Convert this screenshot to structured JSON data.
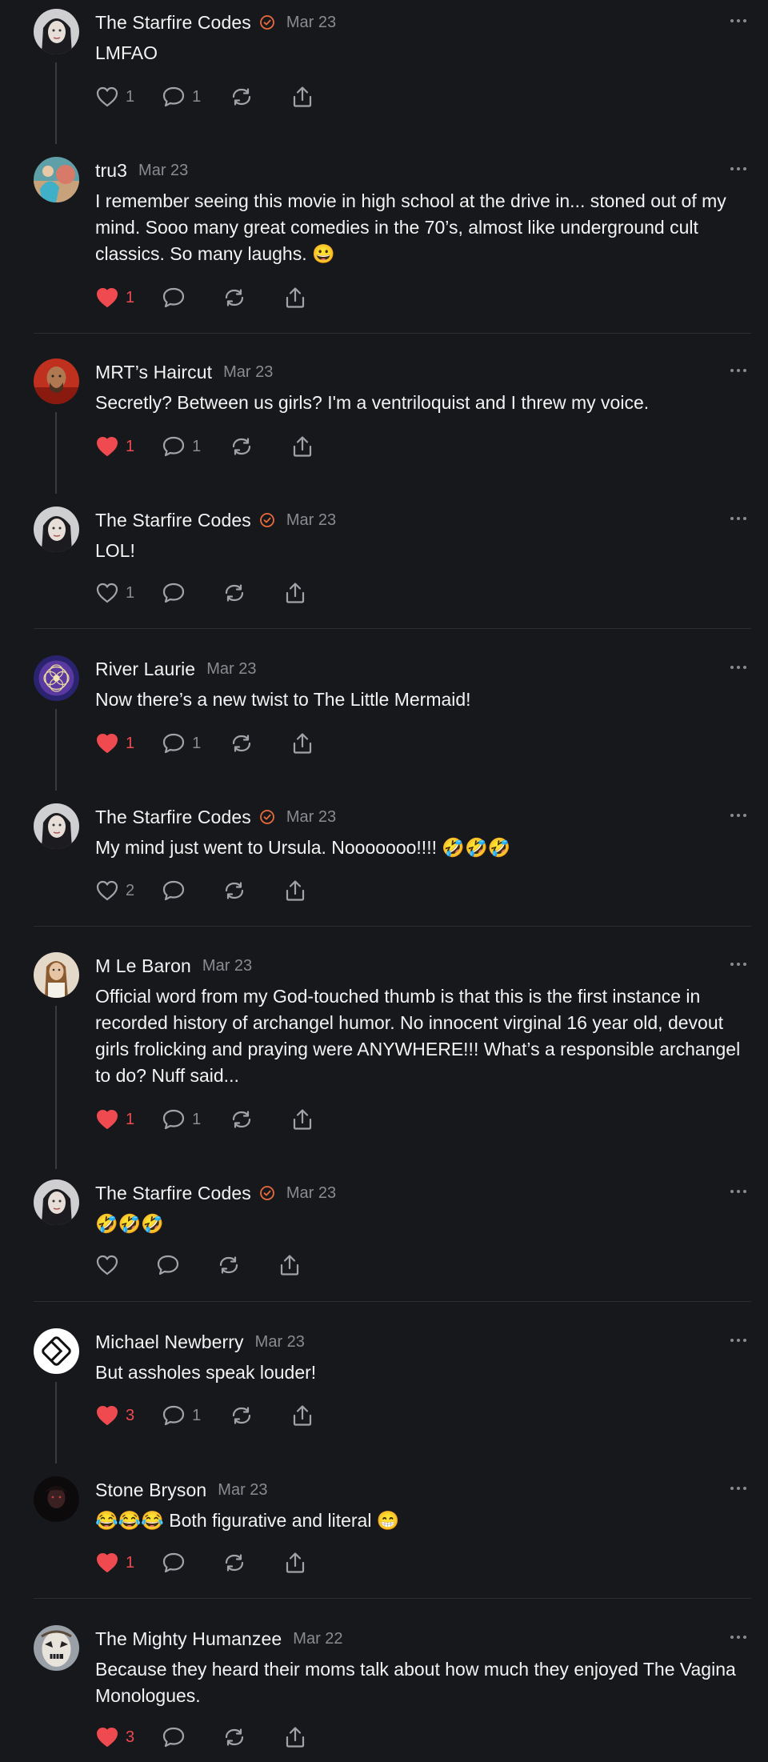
{
  "colors": {
    "background": "#17181b",
    "heart_red": "#ee4a50",
    "verified_orange": "#ea6b3c",
    "muted": "#8a8b90"
  },
  "posts": [
    {
      "author": "The Starfire Codes",
      "verified": true,
      "date": "Mar 23",
      "text": "LMFAO",
      "liked": false,
      "likes": "1",
      "replies": "1",
      "avatar": "woman-avatar"
    },
    {
      "author": "tru3",
      "verified": false,
      "date": "Mar 23",
      "text": "I remember seeing this movie in high school at the drive in... stoned out of my mind. Sooo many great comedies in the 70’s, almost like underground cult classics. So many laughs. 😀",
      "liked": true,
      "likes": "1",
      "replies": "",
      "avatar": "beach-avatar"
    },
    {
      "author": "MRT’s Haircut",
      "verified": false,
      "date": "Mar 23",
      "text": "Secretly? Between us girls? I'm a ventriloquist and I threw my voice.",
      "liked": true,
      "likes": "1",
      "replies": "1",
      "avatar": "man-red-avatar"
    },
    {
      "author": "The Starfire Codes",
      "verified": true,
      "date": "Mar 23",
      "text": "LOL!",
      "liked": false,
      "likes": "1",
      "replies": "",
      "avatar": "woman-avatar"
    },
    {
      "author": "River Laurie",
      "verified": false,
      "date": "Mar 23",
      "text": "Now there’s a new twist to The Little Mermaid!",
      "liked": true,
      "likes": "1",
      "replies": "1",
      "avatar": "mandala-avatar"
    },
    {
      "author": "The Starfire Codes",
      "verified": true,
      "date": "Mar 23",
      "text": "My mind just went to Ursula. Nooooooo!!!! 🤣🤣🤣",
      "liked": false,
      "likes": "2",
      "replies": "",
      "avatar": "woman-avatar"
    },
    {
      "author": "M Le Baron",
      "verified": false,
      "date": "Mar 23",
      "text": "Official word from my God-touched thumb is that this is the first instance in recorded history of archangel humor. No innocent virginal 16 year old, devout girls frolicking and praying were ANYWHERE!!! What’s a responsible archangel to do? Nuff said...",
      "liked": true,
      "likes": "1",
      "replies": "1",
      "avatar": "woman-hair-avatar"
    },
    {
      "author": "The Starfire Codes",
      "verified": true,
      "date": "Mar 23",
      "text": "🤣🤣🤣",
      "liked": false,
      "likes": "",
      "replies": "",
      "avatar": "woman-avatar"
    },
    {
      "author": "Michael Newberry",
      "verified": false,
      "date": "Mar 23",
      "text": "But assholes speak louder!",
      "liked": true,
      "likes": "3",
      "replies": "1",
      "avatar": "logo-avatar"
    },
    {
      "author": "Stone Bryson",
      "verified": false,
      "date": "Mar 23",
      "text": "😂😂😂 Both figurative and literal 😁",
      "liked": true,
      "likes": "1",
      "replies": "",
      "avatar": "dark-avatar"
    },
    {
      "author": "The Mighty Humanzee",
      "verified": false,
      "date": "Mar 22",
      "text": "Because they heard their moms talk about how much they enjoyed The Vagina Monologues.",
      "liked": true,
      "likes": "3",
      "replies": "",
      "avatar": "mask-avatar"
    }
  ]
}
